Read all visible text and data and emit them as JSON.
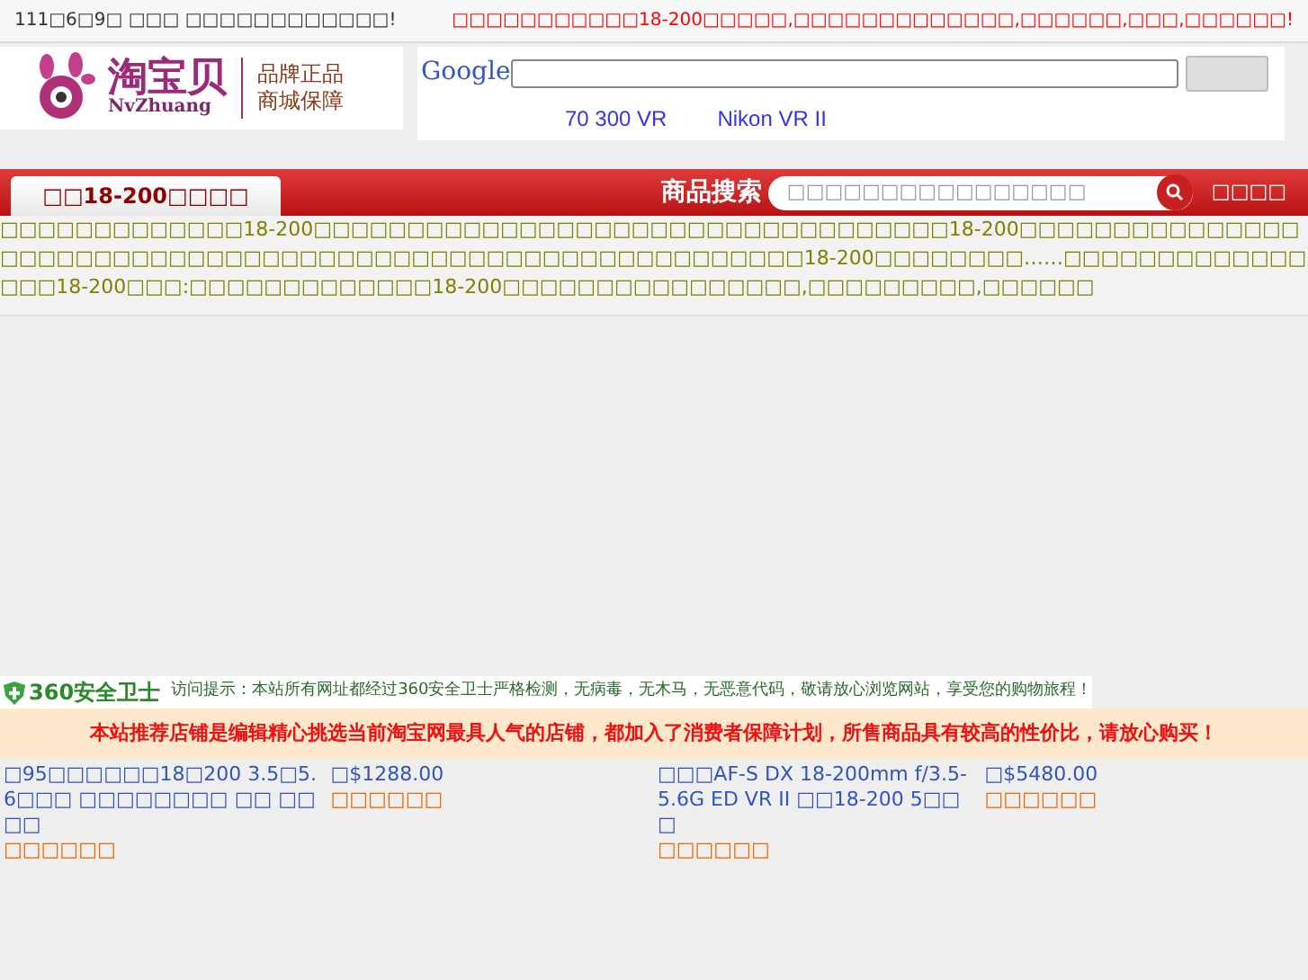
{
  "top_bar": {
    "date_text": "111□6□9□ □□□ □□□□□□□□□□□□!",
    "notice": "□□□□□□□□□□□18-200□□□□□,□□□□□□□□□□□□□,□□□□□□,□□□,□□□□□□!"
  },
  "logo": {
    "name": "淘宝贝",
    "latin": "NvZhuang",
    "slogan_1": "品牌正品",
    "slogan_2": "商城保障"
  },
  "google": {
    "logo": "Google",
    "links": [
      "70 300 VR",
      "Nikon VR II"
    ]
  },
  "nav": {
    "tab": "□□18-200□□□□",
    "search_label": "商品搜索",
    "search_placeholder": "□□□□□□□□□□□□□□□□",
    "search_link": "□□□□"
  },
  "intro": "□□□□□□□□□□□□□18-200□□□□□□□□□□□□□□□□□□□□□□□□□□□□□□□□□□18-200□□□□□□□□□□□□□□□□□□□□□□□□□□□□□□□□□□□□□□□□□□□□□□□□□□□□□□□□□□18-200□□□□□□□□……□□□□□□□□□□□□□□□□18-200□□□:□□□□□□□□□□□□□18-200□□□□□□□□□□□□□□□□,□□□□□□□□□,□□□□□□",
  "safety": {
    "brand": "360安全卫士",
    "message": "访问提示：本站所有网址都经过360安全卫士严格检测，无病毒，无木马，无恶意代码，敬请放心浏览网站，享受您的购物旅程！"
  },
  "recommend_notice": "本站推荐店铺是编辑精心挑选当前淘宝网最具人气的店铺，都加入了消费者保障计划，所售商品具有较高的性价比，请放心购买！",
  "products": [
    {
      "title": "□95□□□□□□18□200 3.5□5.6□□□ □□□□□□□□ □□ □□□□",
      "price": "□$1288.00",
      "shop": "□□□□□□"
    },
    {
      "title": "□□□AF-S DX 18-200mm f/3.5-5.6G ED VR II □□18-200 5□□□",
      "price": "□$5480.00",
      "shop": "□□□□□□"
    }
  ]
}
